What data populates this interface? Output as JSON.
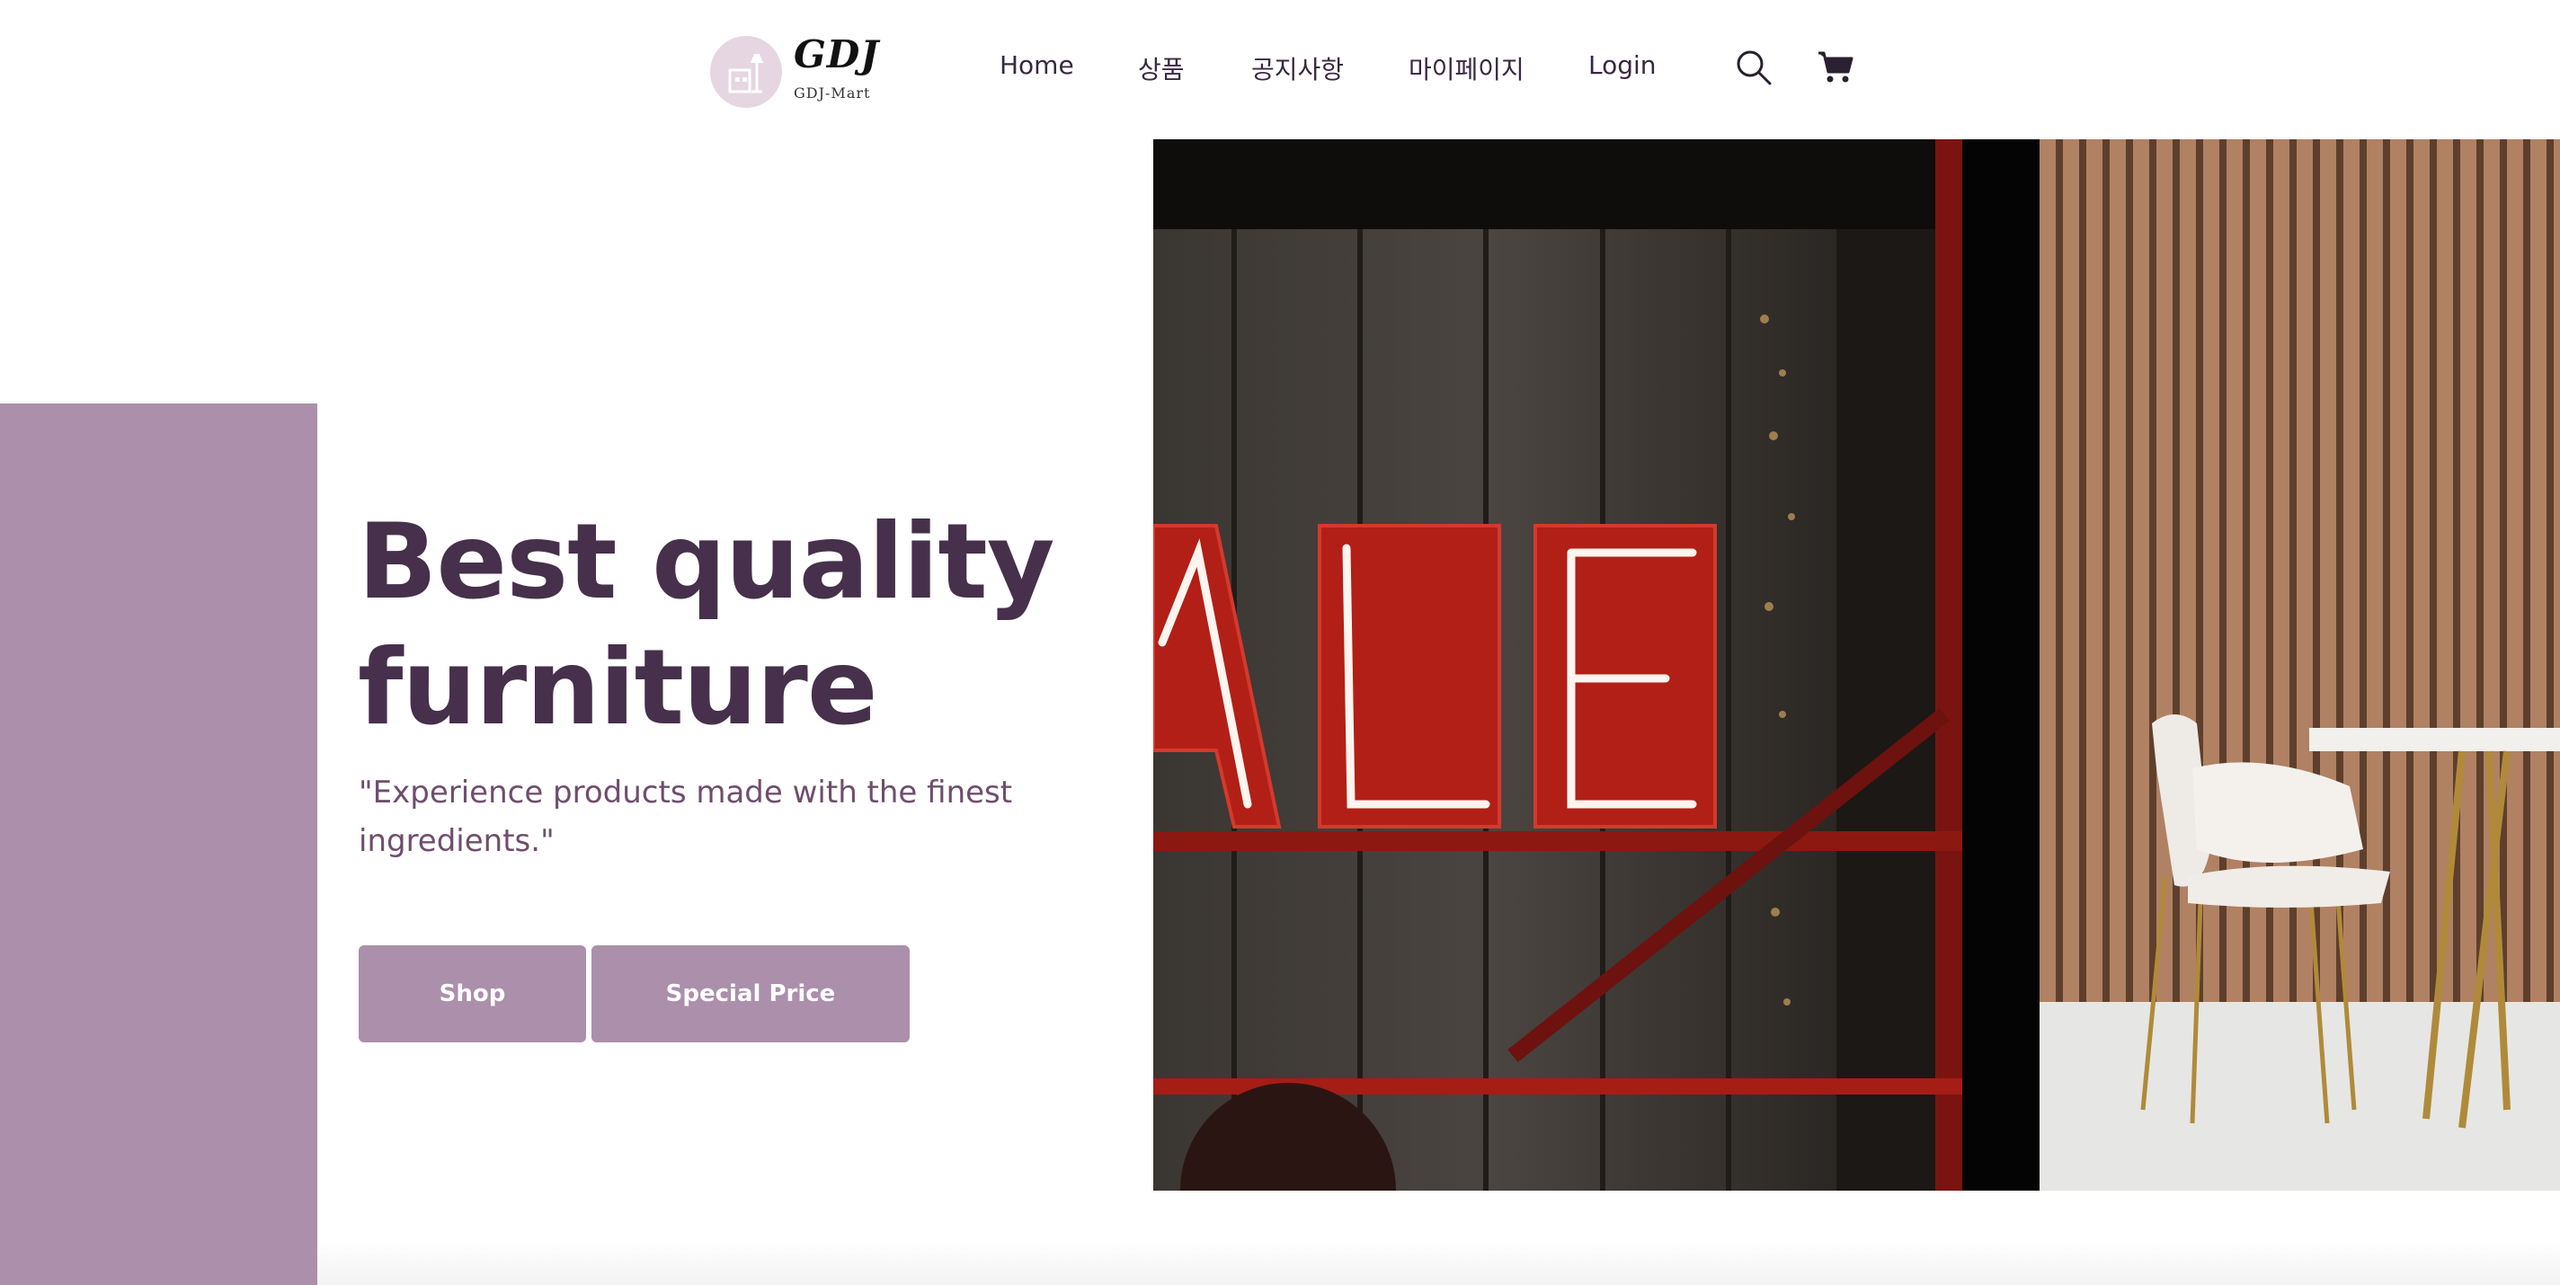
{
  "brand": {
    "logo_script": "GDJ",
    "logo_sub": "GDJ-Mart"
  },
  "nav": {
    "items": [
      {
        "label": "Home"
      },
      {
        "label": "상품"
      },
      {
        "label": "공지사항"
      },
      {
        "label": "마이페이지"
      },
      {
        "label": "Login"
      }
    ],
    "icons": [
      "search-icon",
      "cart-icon"
    ]
  },
  "hero": {
    "title_line1": "Best quality",
    "title_line2": "furniture",
    "subtitle": "\"Experience products made with the finest ingredients.\"",
    "buttons": [
      {
        "label": "Shop"
      },
      {
        "label": "Special Price"
      }
    ],
    "sign_text": "ALE"
  },
  "colors": {
    "accent": "#ab8fab",
    "heading": "#46304b",
    "subtitle": "#6f4e6d",
    "neon_red": "#c0231c"
  }
}
